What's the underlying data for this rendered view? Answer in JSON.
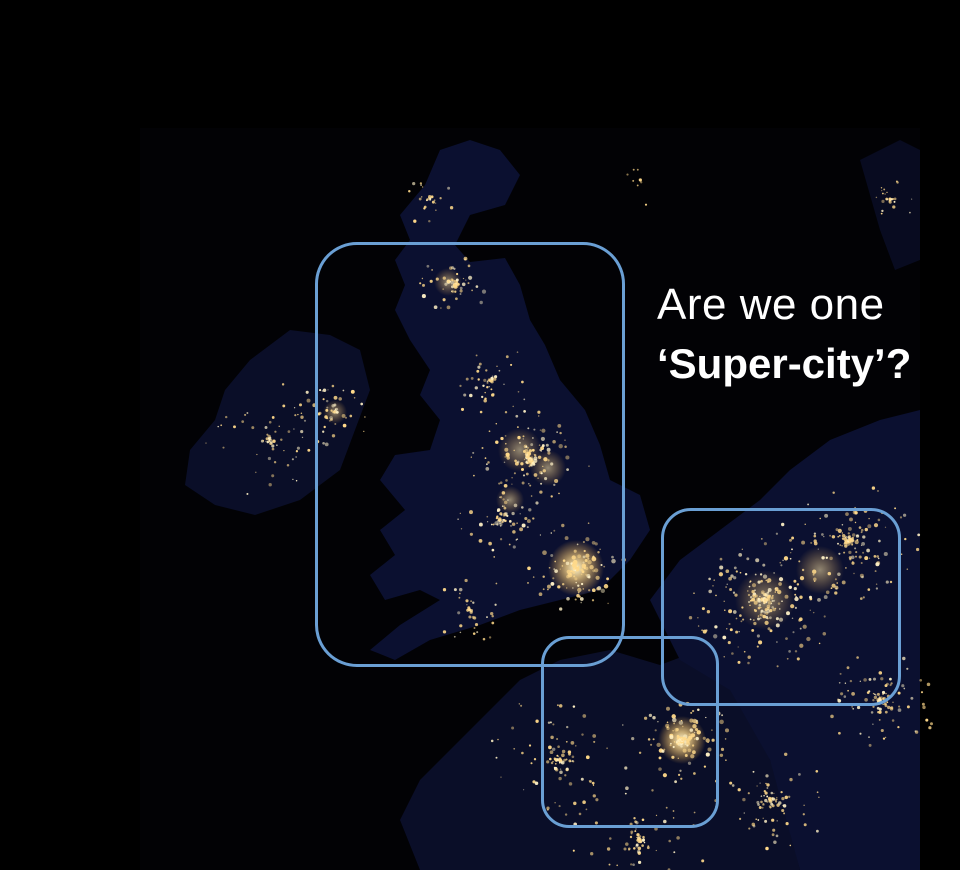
{
  "headline": {
    "line1": "Are we one",
    "line2": "‘Super-city’?"
  },
  "colors": {
    "background": "#000000",
    "headline_text": "#ffffff",
    "box_outline": "#6a9fd4",
    "city_lights": "#ffd98a",
    "land_tint": "#0b1030"
  },
  "image": {
    "subject": "night-lights-satellite-map"
  },
  "highlight_regions": [
    {
      "name": "britain"
    },
    {
      "name": "low-countries"
    },
    {
      "name": "northern-france"
    }
  ]
}
